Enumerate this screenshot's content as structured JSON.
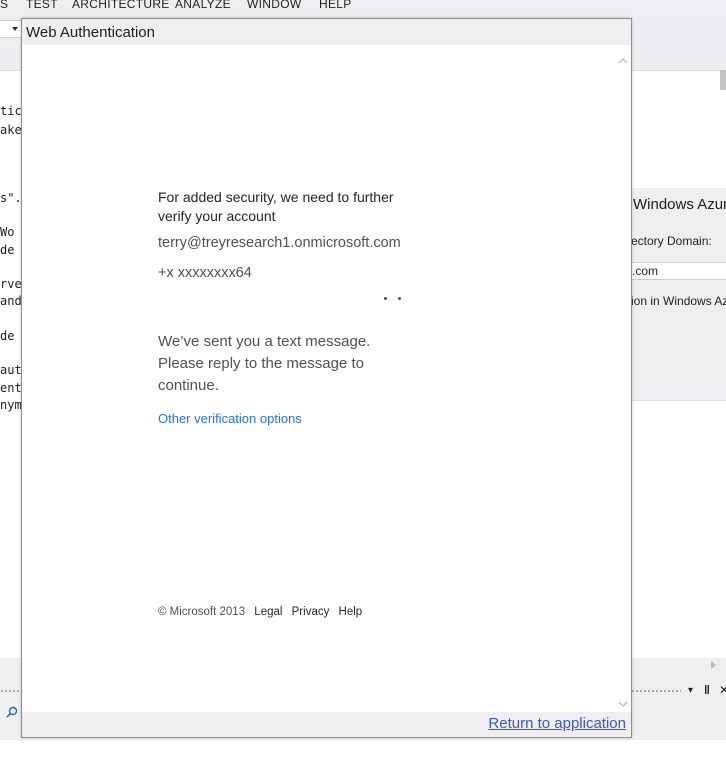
{
  "ide": {
    "menu": [
      "S",
      "TEST",
      "ARCHITECTURE",
      "ANALYZE",
      "WINDOW",
      "HELP"
    ],
    "code_lines": [
      "tic",
      "ake",
      "s\".",
      " Wo",
      "de",
      "rve",
      "and",
      "de",
      "aut",
      "ent",
      "nym"
    ],
    "side_dialog": {
      "title": "Windows Azur",
      "domain_label": "ectory Domain:",
      "domain_value": ".com",
      "checkbox_label": "ion in Windows Az"
    },
    "pin_icon": "‖",
    "close_icon": "✕",
    "dropdown_icon": "▾"
  },
  "dialog": {
    "title": "Web Authentication",
    "heading": "For added security, we need to further verify your account",
    "email": "terry@treyresearch1.onmicrosoft.com",
    "phone": "+x xxxxxxxx64",
    "message": "We’ve sent you a text message. Please reply to the message to continue.",
    "other_options": "Other verification options",
    "footer": {
      "copyright": "© Microsoft 2013",
      "legal": "Legal",
      "privacy": "Privacy",
      "help": "Help"
    },
    "return_link": "Return to application"
  }
}
